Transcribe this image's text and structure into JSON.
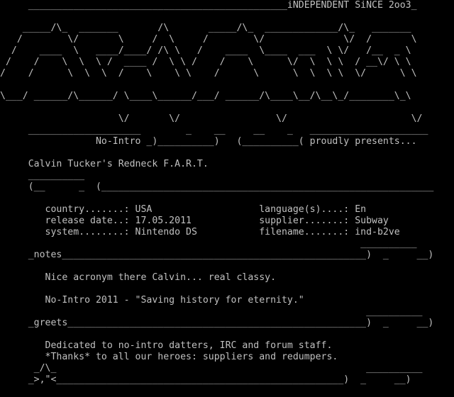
{
  "nfo": {
    "foreground_color": "#c0c0c0",
    "background_color": "#000000",
    "header": {
      "tagline_line": "     ______________________________________________iNDEPENDENT SiNCE 2oo3_",
      "logo_art": [
        "    _____/\\_  _______       /\\       _____/\\_  _____________/\\_   _______",
        "   /        \\/       \\     /  \\     /        \\/              \\/  /       \\",
        "  /    ____  \\   ____/____/ /\\ \\   /    ____  \\____  ___  \\ \\/   /__  _ \\",
        " /    /    \\  \\  \\ /  ____ /  \\ \\ /    /    \\      \\/  \\  \\ \\  / __\\/ \\ \\",
        "/    /      \\  \\  \\  /    \\    \\ \\    /      \\      \\  \\  \\ \\  \\/      \\ \\",
        "\\___/ ______/\\______/ \\____\\______/___/ ______/\\____\\__/\\__\\_/________\\_\\",
        "",
        "                     \\/       \\/                 \\/                      \\/"
      ],
      "presents_line": "     ____________________        _    __     __    _   _____________________",
      "presents_text_line": "                 No-Intro _)__________)   (__________( proudly presents..."
    },
    "release": {
      "title": "     Calvin Tucker's Redneck F.A.R.T.",
      "info_frame_top": "     __________",
      "info_frame_bottom": "     (__      _  (___________________________________________________________",
      "info_rows": [
        "        country.......: USA                   language(s)....: En",
        "        release date..: 17.05.2011            supplier.......: Subway",
        "        system........: Nintendo DS           filename.......: ind-b2ve"
      ]
    },
    "notes_section": {
      "frame_top": "                                                                __________",
      "header": "     _notes______________________________________________________)  _     __)",
      "lines": [
        "        Nice acronym there Calvin... real classy.",
        "",
        "        No-Intro 2011 - \"Saving history for eternity.\""
      ]
    },
    "greets_section": {
      "frame_top": "                                                                 __________",
      "header": "     _greets_____________________________________________________)  _     __)",
      "lines": [
        "        Dedicated to no-intro datters, IRC and forum staff.",
        "        *Thanks* to all our heroes: suppliers and redumpers."
      ]
    },
    "footer": {
      "ornament_line": "      _/\\_                                                       __________",
      "closing_line": "     _>,\"<___________________________________________________)  _     __)"
    }
  }
}
